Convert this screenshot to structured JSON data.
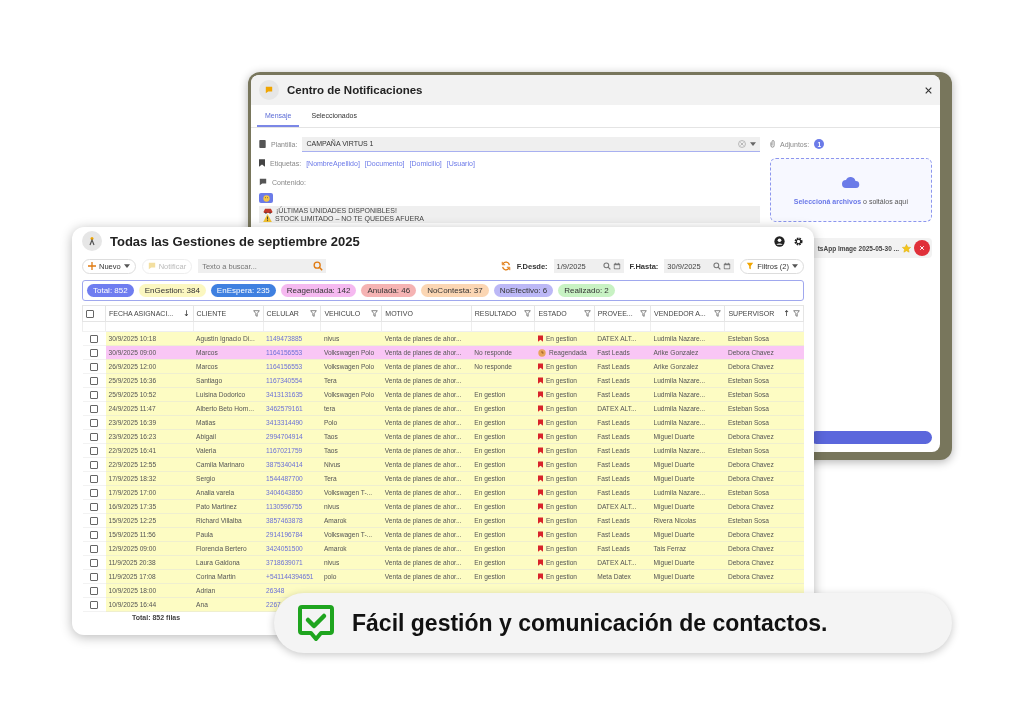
{
  "notification_dialog": {
    "title": "Centro de Notificaciones",
    "tabs": [
      {
        "label": "Mensaje",
        "selected": true
      },
      {
        "label": "Seleccionados",
        "selected": false
      }
    ],
    "template": {
      "label": "Plantilla:",
      "value": "CAMPAÑA VIRTUS 1"
    },
    "tags": {
      "label": "Etiquetas:",
      "items": [
        "[NombreApellido]",
        "[Documento]",
        "[Domicilio]",
        "[Usuario]"
      ]
    },
    "content": {
      "label": "Contenido:",
      "lines": [
        {
          "kind": "car",
          "text": "¡ÚLTIMAS UNIDADES DISPONIBLES!"
        },
        {
          "kind": "warning",
          "text": "STOCK LIMITADO – NO TE QUEDES AFUERA"
        }
      ]
    },
    "attachments": {
      "label": "Adjuntos:",
      "count": "1",
      "dropzone_link": "Seleccioná archivos",
      "dropzone_text": "o soltálos aquí",
      "files": [
        {
          "name": "tsApp Image 2025-05-30 ...",
          "starred": true
        }
      ]
    }
  },
  "main_window": {
    "title": "Todas las Gestiones de septiembre 2025",
    "toolbar": {
      "new_button": "Nuevo",
      "notify_button": {
        "label": "Notificar",
        "disabled": true
      },
      "search": {
        "placeholder": "Texto a buscar..."
      },
      "date_from": {
        "label": "F.Desde:",
        "value": "1/9/2025"
      },
      "date_to": {
        "label": "F.Hasta:",
        "value": "30/9/2025"
      },
      "filters_button": "Filtros (2)"
    },
    "chips": [
      {
        "label": "Total: 852",
        "color": "#6f7df0"
      },
      {
        "label": "EnGestion: 384",
        "color": "#fbf7c0"
      },
      {
        "label": "EnEspera: 235",
        "color": "#3f80e0"
      },
      {
        "label": "Reagendada: 142",
        "color": "#f5b9f0"
      },
      {
        "label": "Anulada: 46",
        "color": "#f5b3b3"
      },
      {
        "label": "NoContesta: 37",
        "color": "#fbd6b3"
      },
      {
        "label": "NoEfectivo: 6",
        "color": "#bcb8f6"
      },
      {
        "label": "Realizado: 2",
        "color": "#c8f2c3"
      }
    ],
    "table": {
      "select_all": {
        "checked": false
      },
      "columns": [
        {
          "label": "FECHA ASIGNACI...",
          "sort": "↓",
          "filter": false
        },
        {
          "label": "CLIENTE",
          "filter": true
        },
        {
          "label": "CELULAR",
          "filter": true
        },
        {
          "label": "VEHICULO",
          "filter": true
        },
        {
          "label": "MOTIVO",
          "filter": false
        },
        {
          "label": "RESULTADO",
          "filter": true
        },
        {
          "label": "ESTADO",
          "filter": true
        },
        {
          "label": "PROVEE...",
          "filter": true
        },
        {
          "label": "VENDEDOR A...",
          "filter": true
        },
        {
          "label": "SUPERVISOR",
          "sort": "↑",
          "filter": true
        }
      ],
      "rows": [
        {
          "checked": false,
          "color": "#fdfcc3",
          "cells": {
            "fecha": "30/9/2025 10:18",
            "cliente": "Agustin Ignacio Di...",
            "celular": "1149473885",
            "vehiculo": "nivus",
            "motivo": "Venta de planes de ahor...",
            "estado": {
              "text": "En gestion",
              "kind": "bookmark"
            },
            "proveedor": "DATEX ALT...",
            "vendedor": "Ludmila Nazare...",
            "supervisor": "Esteban Sosa"
          }
        },
        {
          "checked": false,
          "color": "#f9c6f5",
          "cells": {
            "fecha": "30/9/2025 09:00",
            "cliente": "Marcos",
            "celular": "1164156553",
            "vehiculo": "Volkswagen Polo",
            "motivo": "Venta de planes de ahor...",
            "resultado": "No responde",
            "estado": {
              "text": "Reagendada",
              "kind": "reschedule"
            },
            "proveedor": "Fast Leads",
            "vendedor": "Arike Gonzalez",
            "supervisor": "Debora Chavez"
          }
        },
        {
          "checked": false,
          "color": "#fdfcc3",
          "cells": {
            "fecha": "26/9/2025 12:00",
            "cliente": "Marcos",
            "celular": "1164156553",
            "vehiculo": "Volkswagen Polo",
            "motivo": "Venta de planes de ahor...",
            "resultado": "No responde",
            "estado": {
              "text": "En gestion",
              "kind": "bookmark"
            },
            "proveedor": "Fast Leads",
            "vendedor": "Arike Gonzalez",
            "supervisor": "Debora Chavez"
          }
        },
        {
          "checked": false,
          "color": "#fdfcc3",
          "cells": {
            "fecha": "25/9/2025 16:36",
            "cliente": "Santiago",
            "celular": "1167340554",
            "vehiculo": "Tera",
            "motivo": "Venta de planes de ahor...",
            "estado": {
              "text": "En gestion",
              "kind": "bookmark"
            },
            "proveedor": "Fast Leads",
            "vendedor": "Ludmila Nazare...",
            "supervisor": "Esteban Sosa"
          }
        },
        {
          "checked": false,
          "color": "#fdfcc3",
          "cells": {
            "fecha": "25/9/2025 10:52",
            "cliente": "Luisina Dodorico",
            "celular": "3413131635",
            "vehiculo": "Volkswagen Polo",
            "motivo": "Venta de planes de ahor...",
            "resultado": "En gestion",
            "estado": {
              "text": "En gestion",
              "kind": "bookmark"
            },
            "proveedor": "Fast Leads",
            "vendedor": "Ludmila Nazare...",
            "supervisor": "Esteban Sosa"
          }
        },
        {
          "checked": false,
          "color": "#fdfcc3",
          "cells": {
            "fecha": "24/9/2025 11:47",
            "cliente": "Alberto Beto Horn...",
            "celular": "3462579161",
            "vehiculo": "tera",
            "motivo": "Venta de planes de ahor...",
            "resultado": "En gestion",
            "estado": {
              "text": "En gestion",
              "kind": "bookmark"
            },
            "proveedor": "DATEX ALT...",
            "vendedor": "Ludmila Nazare...",
            "supervisor": "Esteban Sosa"
          }
        },
        {
          "checked": false,
          "color": "#fdfcc3",
          "cells": {
            "fecha": "23/9/2025 16:39",
            "cliente": "Matias",
            "celular": "3413314490",
            "vehiculo": "Polo",
            "motivo": "Venta de planes de ahor...",
            "resultado": "En gestion",
            "estado": {
              "text": "En gestion",
              "kind": "bookmark"
            },
            "proveedor": "Fast Leads",
            "vendedor": "Ludmila Nazare...",
            "supervisor": "Esteban Sosa"
          }
        },
        {
          "checked": false,
          "color": "#fdfcc3",
          "cells": {
            "fecha": "23/9/2025 16:23",
            "cliente": "Abigail",
            "celular": "2994704914",
            "vehiculo": "Taos",
            "motivo": "Venta de planes de ahor...",
            "resultado": "En gestion",
            "estado": {
              "text": "En gestion",
              "kind": "bookmark"
            },
            "proveedor": "Fast Leads",
            "vendedor": "Miguel Duarte",
            "supervisor": "Debora Chavez"
          }
        },
        {
          "checked": false,
          "color": "#fdfcc3",
          "cells": {
            "fecha": "22/9/2025 16:41",
            "cliente": "Valeria",
            "celular": "1167021759",
            "vehiculo": "Taos",
            "motivo": "Venta de planes de ahor...",
            "resultado": "En gestion",
            "estado": {
              "text": "En gestion",
              "kind": "bookmark"
            },
            "proveedor": "Fast Leads",
            "vendedor": "Ludmila Nazare...",
            "supervisor": "Esteban Sosa"
          }
        },
        {
          "checked": false,
          "color": "#fdfcc3",
          "cells": {
            "fecha": "22/9/2025 12:55",
            "cliente": "Camila Marinaro",
            "celular": "3875340414",
            "vehiculo": "Nivus",
            "motivo": "Venta de planes de ahor...",
            "resultado": "En gestion",
            "estado": {
              "text": "En gestion",
              "kind": "bookmark"
            },
            "proveedor": "Fast Leads",
            "vendedor": "Miguel Duarte",
            "supervisor": "Debora Chavez"
          }
        },
        {
          "checked": false,
          "color": "#fdfcc3",
          "cells": {
            "fecha": "17/9/2025 18:32",
            "cliente": "Sergio",
            "celular": "1544487700",
            "vehiculo": "Tera",
            "motivo": "Venta de planes de ahor...",
            "resultado": "En gestion",
            "estado": {
              "text": "En gestion",
              "kind": "bookmark"
            },
            "proveedor": "Fast Leads",
            "vendedor": "Miguel Duarte",
            "supervisor": "Debora Chavez"
          }
        },
        {
          "checked": false,
          "color": "#fdfcc3",
          "cells": {
            "fecha": "17/9/2025 17:00",
            "cliente": "Analia varela",
            "celular": "3404643850",
            "vehiculo": "Volkswagen T-...",
            "motivo": "Venta de planes de ahor...",
            "resultado": "En gestion",
            "estado": {
              "text": "En gestion",
              "kind": "bookmark"
            },
            "proveedor": "Fast Leads",
            "vendedor": "Ludmila Nazare...",
            "supervisor": "Esteban Sosa"
          }
        },
        {
          "checked": false,
          "color": "#fdfcc3",
          "cells": {
            "fecha": "16/9/2025 17:35",
            "cliente": "Pato Martinez",
            "celular": "1130596755",
            "vehiculo": "nivus",
            "motivo": "Venta de planes de ahor...",
            "resultado": "En gestion",
            "estado": {
              "text": "En gestion",
              "kind": "bookmark"
            },
            "proveedor": "DATEX ALT...",
            "vendedor": "Miguel Duarte",
            "supervisor": "Debora Chavez"
          }
        },
        {
          "checked": false,
          "color": "#fdfcc3",
          "cells": {
            "fecha": "15/9/2025 12:25",
            "cliente": "Richard Villalba",
            "celular": "3857463878",
            "vehiculo": "Amarok",
            "motivo": "Venta de planes de ahor...",
            "resultado": "En gestion",
            "estado": {
              "text": "En gestion",
              "kind": "bookmark"
            },
            "proveedor": "Fast Leads",
            "vendedor": "Rivera Nicolas",
            "supervisor": "Esteban Sosa"
          }
        },
        {
          "checked": false,
          "color": "#fdfcc3",
          "cells": {
            "fecha": "15/9/2025 11:56",
            "cliente": "Paula",
            "celular": "2914196784",
            "vehiculo": "Volkswagen T-...",
            "motivo": "Venta de planes de ahor...",
            "resultado": "En gestion",
            "estado": {
              "text": "En gestion",
              "kind": "bookmark"
            },
            "proveedor": "Fast Leads",
            "vendedor": "Miguel Duarte",
            "supervisor": "Debora Chavez"
          }
        },
        {
          "checked": false,
          "color": "#fdfcc3",
          "cells": {
            "fecha": "12/9/2025 09:00",
            "cliente": "Florencia Bertero",
            "celular": "3424051500",
            "vehiculo": "Amarok",
            "motivo": "Venta de planes de ahor...",
            "resultado": "En gestion",
            "estado": {
              "text": "En gestion",
              "kind": "bookmark"
            },
            "proveedor": "Fast Leads",
            "vendedor": "Tais Ferraz",
            "supervisor": "Debora Chavez"
          }
        },
        {
          "checked": false,
          "color": "#fdfcc3",
          "cells": {
            "fecha": "11/9/2025 20:38",
            "cliente": "Laura Galdona",
            "celular": "3718639071",
            "vehiculo": "nivus",
            "motivo": "Venta de planes de ahor...",
            "resultado": "En gestion",
            "estado": {
              "text": "En gestion",
              "kind": "bookmark"
            },
            "proveedor": "DATEX ALT...",
            "vendedor": "Miguel Duarte",
            "supervisor": "Debora Chavez"
          }
        },
        {
          "checked": false,
          "color": "#fdfcc3",
          "cells": {
            "fecha": "11/9/2025 17:08",
            "cliente": "Corina Martin",
            "celular": "+541144394651",
            "vehiculo": "polo",
            "motivo": "Venta de planes de ahor...",
            "resultado": "En gestion",
            "estado": {
              "text": "En gestion",
              "kind": "bookmark"
            },
            "proveedor": "Meta Datex",
            "vendedor": "Miguel Duarte",
            "supervisor": "Debora Chavez"
          }
        },
        {
          "checked": false,
          "color": "#fdfcc3",
          "cells": {
            "fecha": "10/9/2025 18:00",
            "cliente": "Adrian",
            "celular": "26348"
          }
        },
        {
          "checked": false,
          "color": "#fdfcc3",
          "cells": {
            "fecha": "10/9/2025 16:44",
            "cliente": "Ana",
            "celular": "2267"
          }
        }
      ],
      "footer": "Total: 852 filas"
    }
  },
  "banner": {
    "text": "Fácil gestión y comunicación de contactos."
  }
}
